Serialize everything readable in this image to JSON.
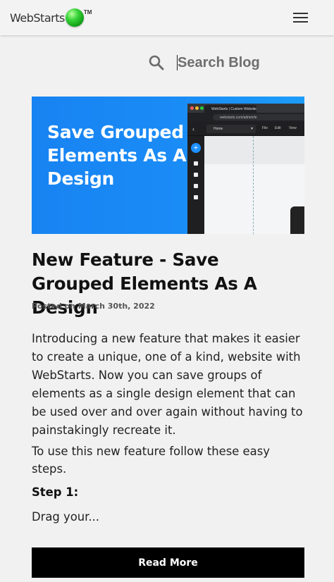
{
  "header": {
    "logo_text": "WebStarts",
    "logo_tm": "TM",
    "menu_icon": "hamburger-menu-icon"
  },
  "search": {
    "icon": "search-icon",
    "placeholder": "Search Blog",
    "value": ""
  },
  "post": {
    "image_text": "Save Grouped Elements As A Design",
    "image_mock": {
      "tab_label": "WebStarts | Custom Website B",
      "url": "webstarts.com/admin/le",
      "page_select": "Home",
      "menu_file": "File",
      "menu_edit": "Edit",
      "menu_view": "View"
    },
    "title": "New Feature - Save Grouped Elements As A Design",
    "date": "Posted on March 30th, 2022",
    "excerpt": "Introducing a new feature that makes it easier to create a unique, one of a kind, website with WebStarts. Now you can save groups of elements as a single design element that can be used over and over again without having to painstakingly recreate it.",
    "paragraph2": "To use this new feature follow these easy steps.",
    "step_heading": "Step 1:",
    "step_text": "Drag your...",
    "read_more_label": "Read More"
  },
  "colors": {
    "accent_blue": "#1a8cf6",
    "button_bg": "#000000",
    "page_bg": "#f1f1f1"
  }
}
